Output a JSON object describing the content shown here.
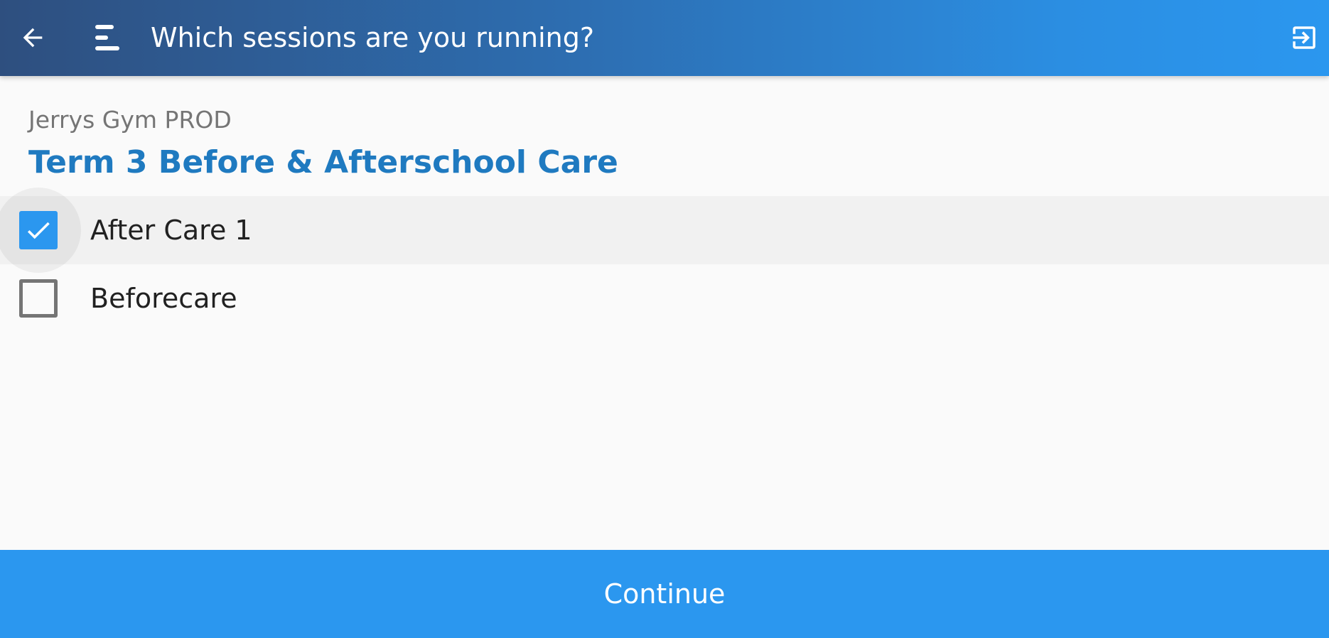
{
  "appbar": {
    "title": "Which sessions are you running?",
    "back_icon": "arrow-left-icon",
    "menu_icon": "menu-icon",
    "exit_icon": "exit-to-app-icon",
    "gradient_colors": [
      "#2e4f7f",
      "#2b97ef"
    ]
  },
  "header": {
    "organization": "Jerrys Gym PROD",
    "term": "Term 3 Before & Afterschool Care",
    "term_color": "#1f7ac0"
  },
  "sessions": [
    {
      "label": "After Care 1",
      "checked": true
    },
    {
      "label": "Beforecare",
      "checked": false
    }
  ],
  "footer": {
    "continue_label": "Continue",
    "accent_color": "#2b97ef"
  }
}
